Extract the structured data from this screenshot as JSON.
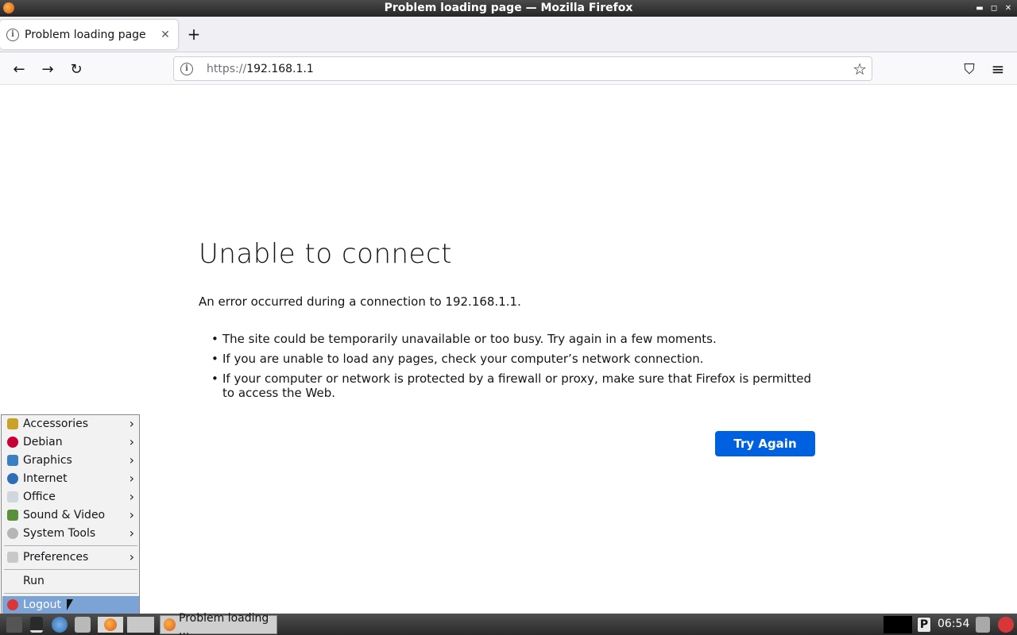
{
  "window": {
    "title": "Problem loading page — Mozilla Firefox",
    "controls": [
      "▬",
      "◻",
      "✕"
    ]
  },
  "tab": {
    "title": "Problem loading page",
    "close": "✕",
    "new_tab": "+"
  },
  "nav": {
    "back": "←",
    "forward": "→",
    "reload": "↻",
    "url_scheme": "https://",
    "url_host": "192.168.1.1",
    "bookmark": "☆",
    "pocket": "⛉",
    "menu": "≡"
  },
  "error": {
    "title": "Unable to connect",
    "description": "An error occurred during a connection to 192.168.1.1.",
    "bullets": [
      "The site could be temporarily unavailable or too busy. Try again in a few moments.",
      "If you are unable to load any pages, check your computer’s network connection.",
      "If your computer or network is protected by a firewall or proxy, make sure that Firefox is permitted to access the Web."
    ],
    "button": "Try Again"
  },
  "start_menu": {
    "items": [
      {
        "label": "Accessories",
        "icon": "accessories-icon",
        "color": "#c9a227"
      },
      {
        "label": "Debian",
        "icon": "debian-icon",
        "color": "#c70036"
      },
      {
        "label": "Graphics",
        "icon": "graphics-icon",
        "color": "#3a7fc1"
      },
      {
        "label": "Internet",
        "icon": "internet-icon",
        "color": "#2f6db5"
      },
      {
        "label": "Office",
        "icon": "office-icon",
        "color": "#9aa7b8"
      },
      {
        "label": "Sound & Video",
        "icon": "sound-video-icon",
        "color": "#5a8f3c"
      },
      {
        "label": "System Tools",
        "icon": "system-tools-icon",
        "color": "#9a9a9a"
      }
    ],
    "preferences": "Preferences",
    "run": "Run",
    "logout": "Logout"
  },
  "taskbar": {
    "task_label": "Problem loading ...",
    "clock": "06:54",
    "pager_label": "P"
  }
}
